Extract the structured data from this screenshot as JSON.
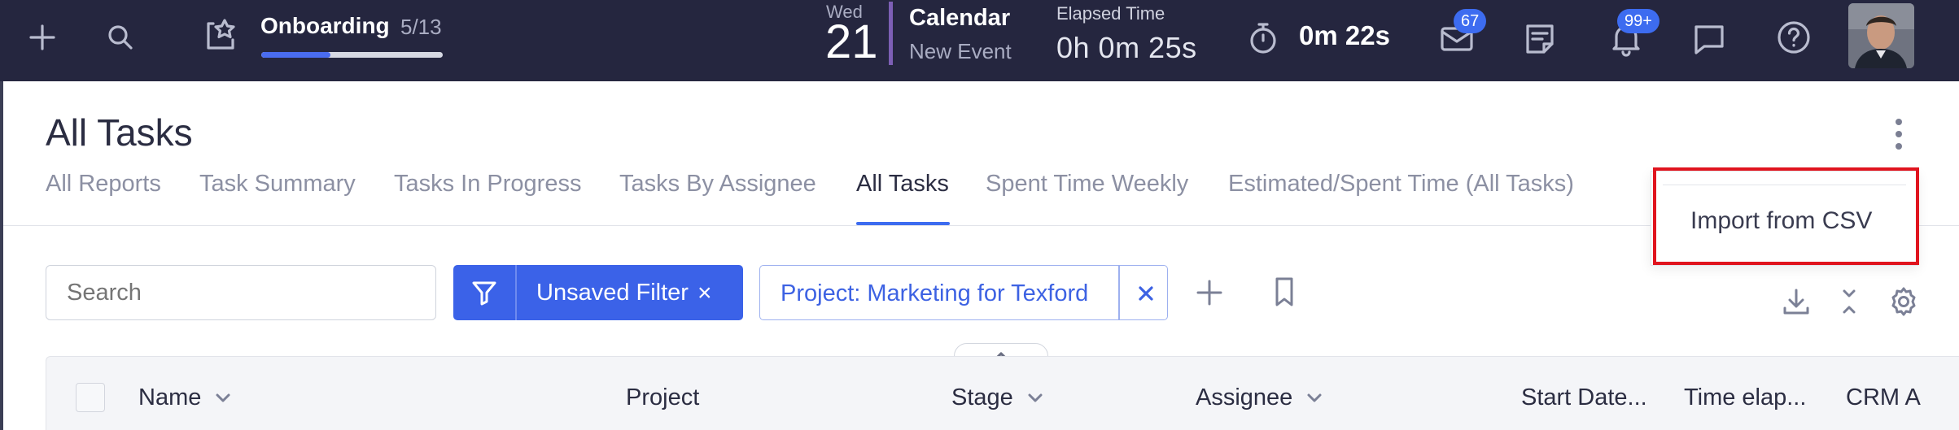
{
  "topbar": {
    "onboarding": {
      "title": "Onboarding",
      "count": "5/13",
      "progress": 0.38
    },
    "calendar": {
      "weekday": "Wed",
      "day": "21",
      "title": "Calendar",
      "subtitle": "New Event"
    },
    "elapsed": {
      "label": "Elapsed Time",
      "value": "0h 0m 25s"
    },
    "timer": {
      "value": "0m 22s"
    },
    "badges": {
      "mail": "67",
      "notifications": "99+"
    },
    "icons": [
      "plus-icon",
      "search-icon",
      "onboarding-icon",
      "stopwatch-icon",
      "mail-icon",
      "notes-icon",
      "bell-icon",
      "chat-icon",
      "help-icon"
    ]
  },
  "page": {
    "title": "All Tasks"
  },
  "tabs": [
    {
      "label": "All Reports"
    },
    {
      "label": "Task Summary"
    },
    {
      "label": "Tasks In Progress"
    },
    {
      "label": "Tasks By Assignee"
    },
    {
      "label": "All Tasks",
      "active": true
    },
    {
      "label": "Spent Time Weekly"
    },
    {
      "label": "Estimated/Spent Time (All Tasks)"
    }
  ],
  "dropdown": {
    "items": [
      "Import from CSV"
    ]
  },
  "filters": {
    "search_placeholder": "Search",
    "unsaved_label": "Unsaved Filter",
    "project_chip": "Project: Marketing for Texford",
    "remove_symbol": "×"
  },
  "table": {
    "columns": [
      "Name",
      "Project",
      "Stage",
      "Assignee",
      "Start Date...",
      "Time elap...",
      "CRM A"
    ]
  },
  "colors": {
    "topbar_bg": "#25263f",
    "accent": "#3b62e8",
    "highlight": "#e0141e"
  }
}
